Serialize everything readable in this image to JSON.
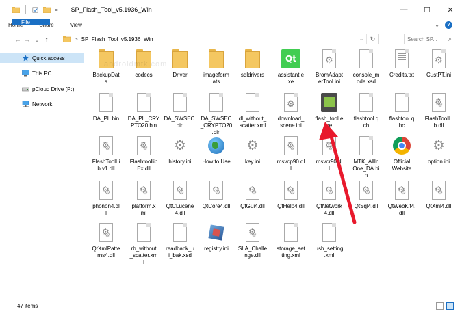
{
  "window": {
    "title": "SP_Flash_Tool_v5.1936_Win",
    "minimize": "—",
    "maximize": "☐",
    "close": "✕"
  },
  "ribbon": {
    "tabs": [
      "File",
      "Home",
      "Share",
      "View"
    ],
    "expand": "⌄",
    "help": "?"
  },
  "nav": {
    "back": "←",
    "forward": "→",
    "recent": "⌄",
    "up": "↑",
    "address": "SP_Flash_Tool_v5.1936_Win",
    "address_sep": ">",
    "refresh": "↻",
    "search_placeholder": "Search SP..."
  },
  "sidebar": {
    "items": [
      {
        "label": "Quick access",
        "icon": "star-icon",
        "selected": true
      },
      {
        "label": "This PC",
        "icon": "computer-icon",
        "selected": false
      },
      {
        "label": "pCloud Drive (P:)",
        "icon": "drive-icon",
        "selected": false
      },
      {
        "label": "Network",
        "icon": "network-icon",
        "selected": false
      }
    ]
  },
  "files": [
    {
      "name": "BackupData",
      "type": "folder"
    },
    {
      "name": "codecs",
      "type": "folder"
    },
    {
      "name": "Driver",
      "type": "folder"
    },
    {
      "name": "imageformats",
      "type": "folder"
    },
    {
      "name": "sqldrivers",
      "type": "folder"
    },
    {
      "name": "assistant.exe",
      "type": "qt"
    },
    {
      "name": "BromAdapterTool.ini",
      "type": "gear-doc"
    },
    {
      "name": "console_mode.xsd",
      "type": "doc"
    },
    {
      "name": "Credits.txt",
      "type": "text"
    },
    {
      "name": "CustPT.ini",
      "type": "gear-doc"
    },
    {
      "name": "DA_PL.bin",
      "type": "doc"
    },
    {
      "name": "DA_PL_CRYPTO20.bin",
      "type": "doc"
    },
    {
      "name": "DA_SWSEC.bin",
      "type": "doc"
    },
    {
      "name": "DA_SWSEC_CRYPTO20.bin",
      "type": "doc"
    },
    {
      "name": "dl_without_scatter.xml",
      "type": "doc"
    },
    {
      "name": "download_scene.ini",
      "type": "gear-doc"
    },
    {
      "name": "flash_tool.exe",
      "type": "flash"
    },
    {
      "name": "flashtool.qch",
      "type": "doc"
    },
    {
      "name": "flashtool.qhc",
      "type": "doc"
    },
    {
      "name": "FlashToolLib.dll",
      "type": "dll"
    },
    {
      "name": "FlashToolLib.v1.dll",
      "type": "dll"
    },
    {
      "name": "FlashtoollibEx.dll",
      "type": "dll"
    },
    {
      "name": "history.ini",
      "type": "gear"
    },
    {
      "name": "How to Use",
      "type": "globe"
    },
    {
      "name": "key.ini",
      "type": "gear"
    },
    {
      "name": "msvcp90.dll",
      "type": "dll"
    },
    {
      "name": "msvcr90.dll",
      "type": "dll"
    },
    {
      "name": "MTK_AllInOne_DA.bin",
      "type": "doc"
    },
    {
      "name": "Official Website",
      "type": "chrome"
    },
    {
      "name": "option.ini",
      "type": "gear"
    },
    {
      "name": "phonon4.dll",
      "type": "dll"
    },
    {
      "name": "platform.xml",
      "type": "dll"
    },
    {
      "name": "QtCLucene4.dll",
      "type": "dll"
    },
    {
      "name": "QtCore4.dll",
      "type": "dll"
    },
    {
      "name": "QtGui4.dll",
      "type": "dll"
    },
    {
      "name": "QtHelp4.dll",
      "type": "dll"
    },
    {
      "name": "QtNetwork4.dll",
      "type": "dll"
    },
    {
      "name": "QtSql4.dll",
      "type": "dll"
    },
    {
      "name": "QtWebKit4.dll",
      "type": "dll"
    },
    {
      "name": "QtXml4.dll",
      "type": "dll"
    },
    {
      "name": "QtXmlPatterns4.dll",
      "type": "dll"
    },
    {
      "name": "rb_without_scatter.xml",
      "type": "doc"
    },
    {
      "name": "readback_ui_bak.xsd",
      "type": "doc"
    },
    {
      "name": "registry.ini",
      "type": "registry"
    },
    {
      "name": "SLA_Challenge.dll",
      "type": "dll"
    },
    {
      "name": "storage_setting.xml",
      "type": "doc"
    },
    {
      "name": "usb_setting.xml",
      "type": "doc"
    }
  ],
  "file_labels_display": [
    "BackupDat\na",
    "codecs",
    "Driver",
    "imageform\nats",
    "sqldrivers",
    "assistant.e\nxe",
    "BromAdapt\nerTool.ini",
    "console_m\node.xsd",
    "Credits.txt",
    "CustPT.ini",
    "DA_PL.bin",
    "DA_PL_CRY\nPTO20.bin",
    "DA_SWSEC.\nbin",
    "DA_SWSEC\n_CRYPTO20\n.bin",
    "dl_without_\nscatter.xml",
    "download_\nscene.ini",
    "flash_tool.e\nxe",
    "flashtool.q\nch",
    "flashtool.q\nhc",
    "FlashToolLi\nb.dll",
    "FlashToolLi\nb.v1.dll",
    "Flashtoollib\nEx.dll",
    "history.ini",
    "How to Use",
    "key.ini",
    "msvcp90.dl\nl",
    "msvcr90.dl\nl",
    "MTK_AllIn\nOne_DA.bi\nn",
    "Official\nWebsite",
    "option.ini",
    "phonon4.dl\nl",
    "platform.x\nml",
    "QtCLucene\n4.dll",
    "QtCore4.dll",
    "QtGui4.dll",
    "QtHelp4.dll",
    "QtNetwork\n4.dll",
    "QtSql4.dll",
    "QtWebKit4.\ndll",
    "QtXml4.dll",
    "QtXmlPatte\nrns4.dll",
    "rb_without\n_scatter.xm\nl",
    "readback_u\ni_bak.xsd",
    "registry.ini",
    "SLA_Challe\nnge.dll",
    "storage_set\nting.xml",
    "usb_setting\n.xml"
  ],
  "status": {
    "items_count": "47 items"
  },
  "watermark": "androidmtk.com",
  "colors": {
    "accent": "#1a6fc4",
    "selected": "#cce4f7",
    "arrow": "#e8192c"
  }
}
